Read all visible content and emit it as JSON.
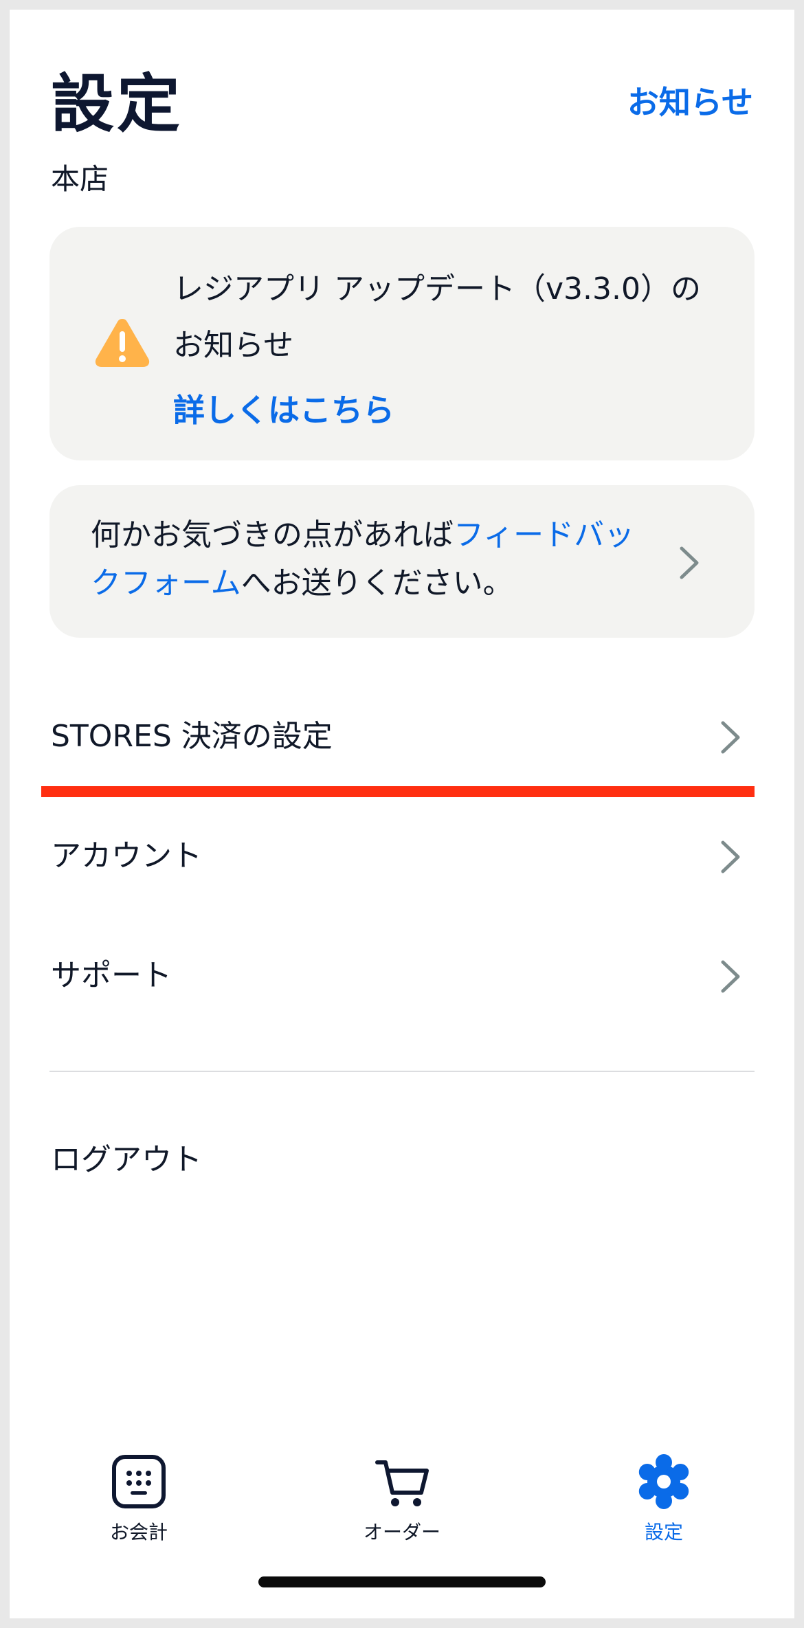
{
  "header": {
    "title": "設定",
    "notify_link": "お知らせ"
  },
  "store_name": "本店",
  "update_notice": {
    "icon": "warning-icon",
    "text": "レジアプリ アップデート（v3.3.0）のお知らせ",
    "detail_link": "詳しくはこちら"
  },
  "feedback": {
    "text_before": "何かお気づきの点があれば",
    "link": "フィードバックフォーム",
    "text_after": "へお送りください。"
  },
  "menu": {
    "stores_payment": "STORES 決済の設定",
    "account": "アカウント",
    "support": "サポート",
    "logout": "ログアウト"
  },
  "tabbar": {
    "items": [
      {
        "label": "お会計",
        "icon": "register-icon",
        "active": false
      },
      {
        "label": "オーダー",
        "icon": "cart-icon",
        "active": false
      },
      {
        "label": "設定",
        "icon": "gear-icon",
        "active": true
      }
    ]
  },
  "colors": {
    "accent": "#0a6be8",
    "warning": "#ffb34a",
    "highlight": "#ff2f11",
    "card_bg": "#f3f3f1",
    "text": "#101828"
  }
}
